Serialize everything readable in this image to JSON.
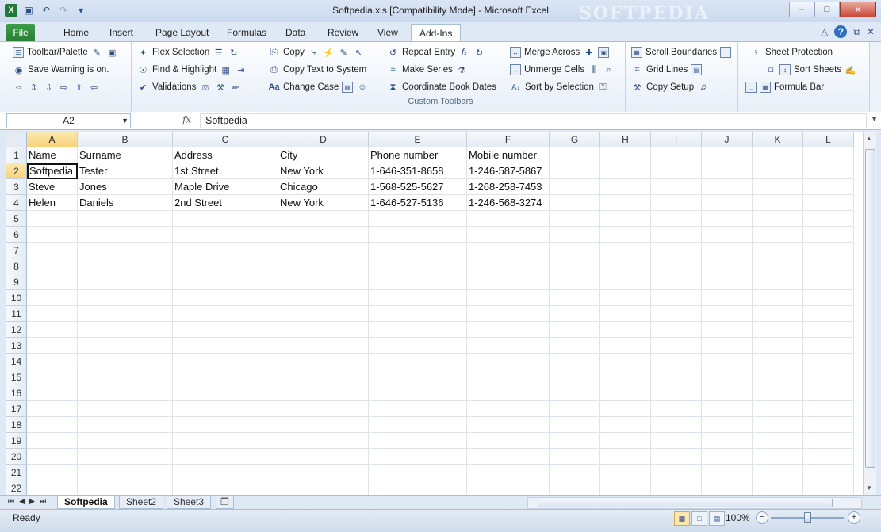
{
  "window": {
    "title": "Softpedia.xls  [Compatibility Mode]  -  Microsoft Excel",
    "watermark": "SOFTPEDIA"
  },
  "ribbon_tabs": [
    "File",
    "Home",
    "Insert",
    "Page Layout",
    "Formulas",
    "Data",
    "Review",
    "View",
    "Add-Ins"
  ],
  "active_tab": "Add-Ins",
  "ribbon": {
    "g1": [
      "Toolbar/Palette",
      "Save Warning is on."
    ],
    "g2": [
      "Flex Selection",
      "Find & Highlight",
      "Validations"
    ],
    "g3": [
      "Copy",
      "Copy Text to System",
      "Change Case"
    ],
    "g4": [
      "Repeat Entry",
      "Make Series",
      "Coordinate Book Dates"
    ],
    "g5": [
      "Merge Across",
      "Unmerge Cells",
      "Sort by Selection"
    ],
    "g6": [
      "Scroll Boundaries",
      "Grid Lines",
      "Copy Setup"
    ],
    "g7": [
      "Sheet Protection",
      "Sort Sheets",
      "Formula Bar"
    ],
    "group_label": "Custom Toolbars"
  },
  "formula_bar": {
    "name_box": "A2",
    "fx": "fx",
    "value": "Softpedia"
  },
  "columns": [
    "A",
    "B",
    "C",
    "D",
    "E",
    "F",
    "G",
    "H",
    "I",
    "J",
    "K",
    "L"
  ],
  "rows": [
    "1",
    "2",
    "3",
    "4",
    "5",
    "6",
    "7",
    "8",
    "9",
    "10",
    "11",
    "12",
    "13",
    "14",
    "15",
    "16",
    "17",
    "18",
    "19",
    "20",
    "21",
    "22"
  ],
  "cells": [
    [
      "Name",
      "Surname",
      "Address",
      "City",
      "Phone number",
      "Mobile number"
    ],
    [
      "Softpedia",
      "Tester",
      "1st Street",
      "New York",
      "1-646-351-8658",
      "1-246-587-5867"
    ],
    [
      "Steve",
      "Jones",
      "Maple Drive",
      "Chicago",
      "1-568-525-5627",
      "1-268-258-7453"
    ],
    [
      "Helen",
      "Daniels",
      "2nd Street",
      "New York",
      "1-646-527-5136",
      "1-246-568-3274"
    ]
  ],
  "sheets": [
    "Softpedia",
    "Sheet2",
    "Sheet3"
  ],
  "active_sheet": "Softpedia",
  "status": {
    "ready": "Ready",
    "zoom": "100%"
  }
}
